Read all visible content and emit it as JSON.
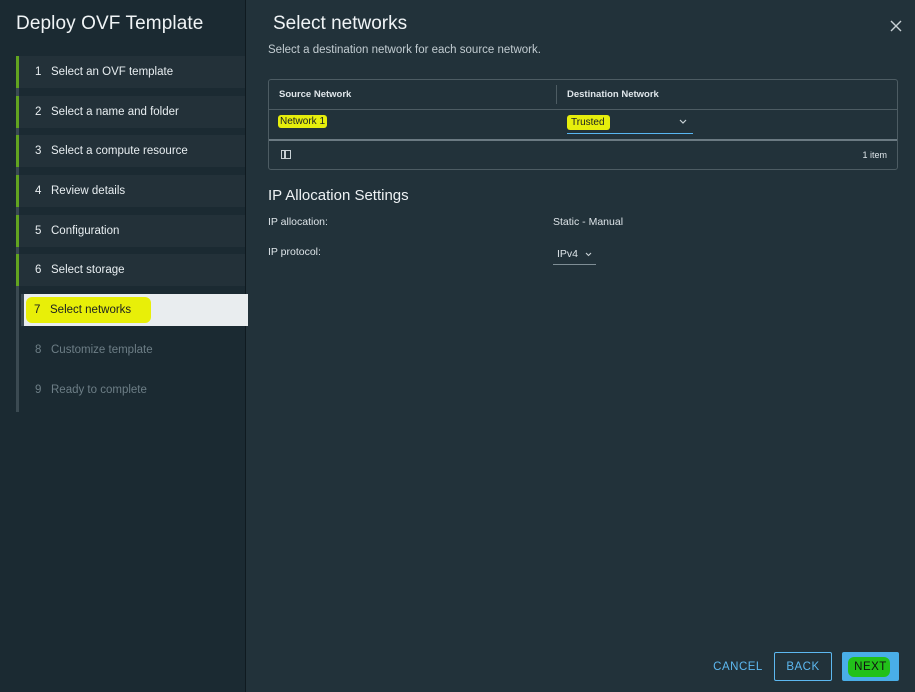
{
  "wizard": {
    "title": "Deploy OVF Template",
    "steps": [
      {
        "num": "1",
        "label": "Select an OVF template",
        "state": "done"
      },
      {
        "num": "2",
        "label": "Select a name and folder",
        "state": "done"
      },
      {
        "num": "3",
        "label": "Select a compute resource",
        "state": "done"
      },
      {
        "num": "4",
        "label": "Review details",
        "state": "done"
      },
      {
        "num": "5",
        "label": "Configuration",
        "state": "done"
      },
      {
        "num": "6",
        "label": "Select storage",
        "state": "done"
      },
      {
        "num": "7",
        "label": "Select networks",
        "state": "active"
      },
      {
        "num": "8",
        "label": "Customize template",
        "state": "disabled"
      },
      {
        "num": "9",
        "label": "Ready to complete",
        "state": "disabled"
      }
    ]
  },
  "page": {
    "title": "Select networks",
    "subtitle": "Select a destination network for each source network."
  },
  "network_grid": {
    "columns": [
      "Source Network",
      "Destination Network"
    ],
    "rows": [
      {
        "source": "Network 1",
        "destination": "Trusted"
      }
    ],
    "item_count": "1 item"
  },
  "ip_allocation": {
    "section_title": "IP Allocation Settings",
    "allocation_label": "IP allocation:",
    "allocation_value": "Static - Manual",
    "protocol_label": "IP protocol:",
    "protocol_value": "IPv4"
  },
  "footer": {
    "cancel": "CANCEL",
    "back": "BACK",
    "next": "NEXT"
  },
  "colors": {
    "accent": "#49aee8",
    "step_complete": "#62a420",
    "highlight_yellow": "#e6ee0c",
    "highlight_green": "#22c11a"
  },
  "icons": {
    "close": "close-icon",
    "dropdown": "chevron-down-icon",
    "columns": "column-toggle-icon"
  }
}
